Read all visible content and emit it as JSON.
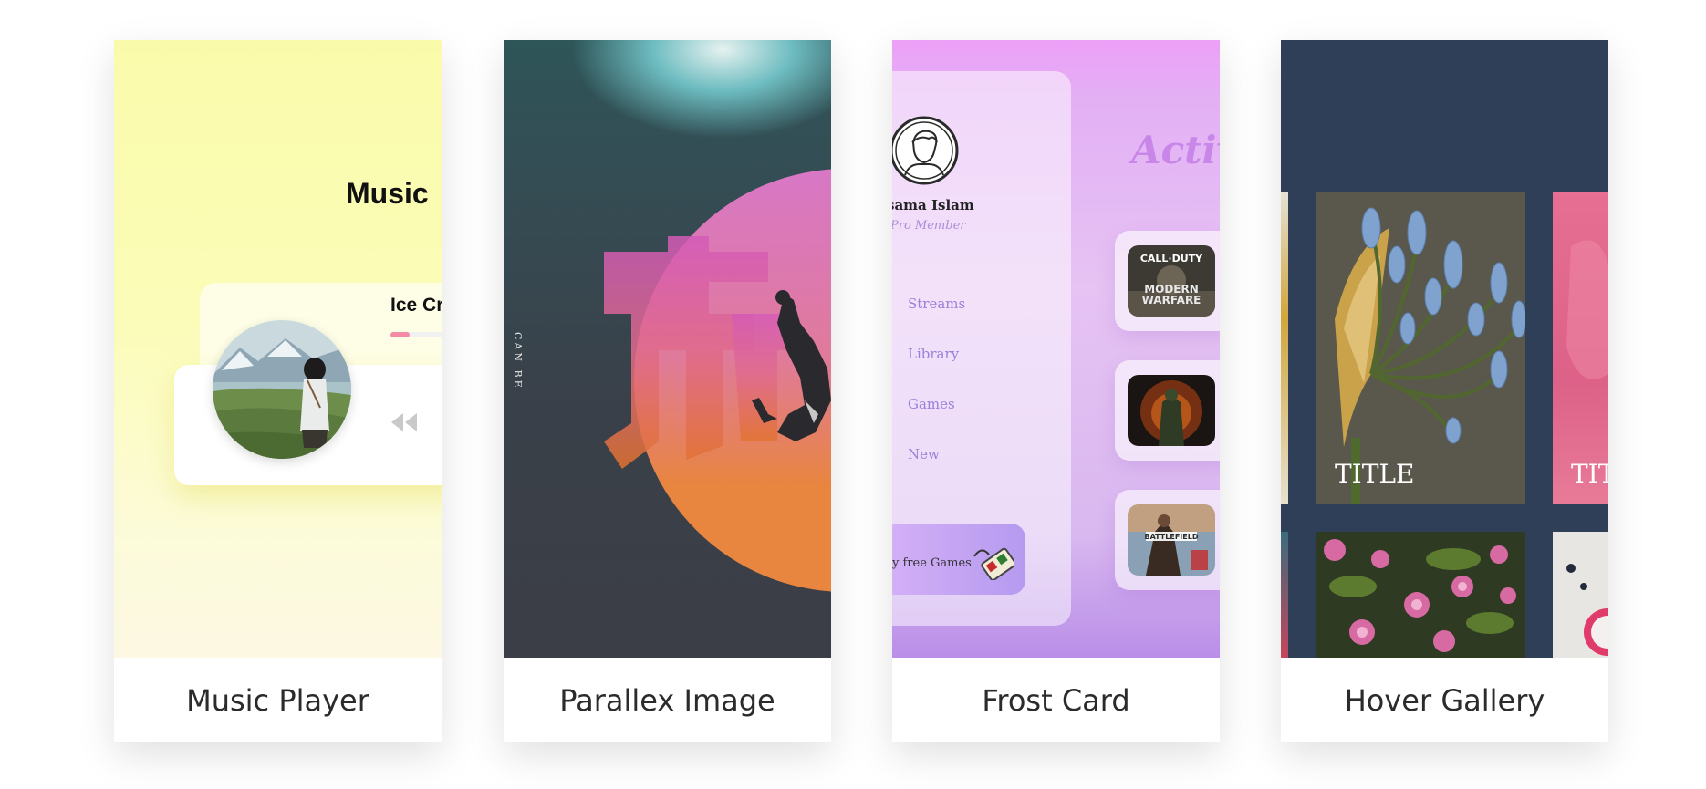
{
  "cards": [
    {
      "caption": "Music Player"
    },
    {
      "caption": "Parallex Image"
    },
    {
      "caption": "Frost Card"
    },
    {
      "caption": "Hover Gallery"
    }
  ],
  "music_player": {
    "title": "Music",
    "song": "Ice Cr",
    "progress": 0.3,
    "icons": [
      "album-art",
      "rewind-icon"
    ]
  },
  "parallax": {
    "vertical_text": "CAN BE",
    "glyph": "改"
  },
  "frost": {
    "heading": "Activ",
    "user_name": "sama Islam",
    "membership": "Pro Member",
    "nav": [
      "Streams",
      "Library",
      "Games",
      "New"
    ],
    "promo": "y free Games",
    "game_titles": [
      "CALL·DUTY",
      "MODERN",
      "WARFARE",
      "BATTLEFIELD"
    ]
  },
  "gallery": {
    "tile_titles": [
      "TITLE",
      "TIT"
    ]
  }
}
